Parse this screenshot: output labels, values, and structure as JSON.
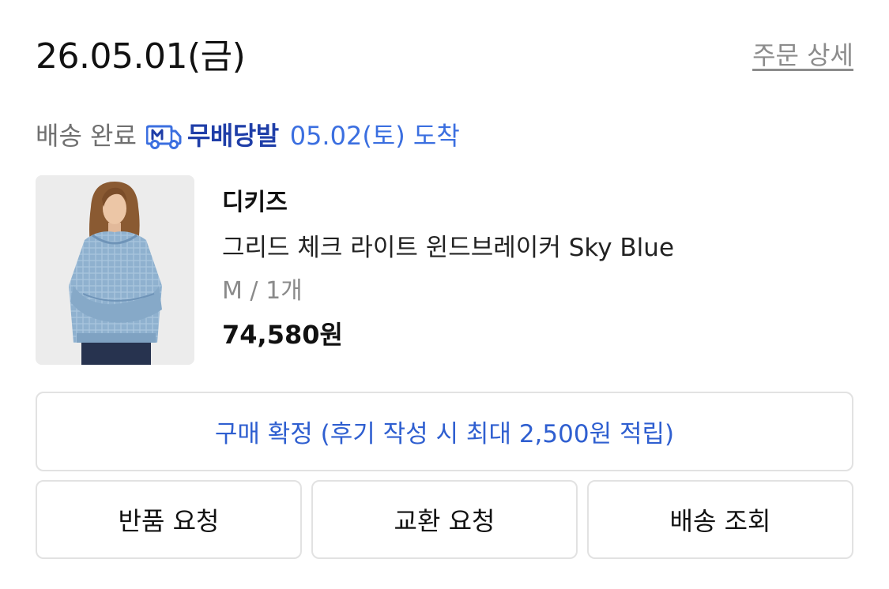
{
  "order": {
    "date": "26.05.01(금)",
    "detail_link": "주문 상세"
  },
  "delivery": {
    "status": "배송 완료",
    "icon": "m-delivery-truck-icon",
    "service_name": "무배당발",
    "arrival": "05.02(토) 도착"
  },
  "product": {
    "image_alt": "그리드 체크 라이트 윈드브레이커 Sky Blue",
    "brand": "디키즈",
    "name": "그리드 체크 라이트 윈드브레이커 Sky Blue",
    "option": "M / 1개",
    "price": "74,580원"
  },
  "actions": {
    "confirm": "구매 확정 (후기 작성 시 최대 2,500원 적립)",
    "return": "반품 요청",
    "exchange": "교환 요청",
    "tracking": "배송 조회"
  },
  "colors": {
    "brand_blue": "#1f3ea8",
    "accent_blue": "#3b6fe0",
    "muted_text": "#707070",
    "border": "#e2e2e2"
  }
}
